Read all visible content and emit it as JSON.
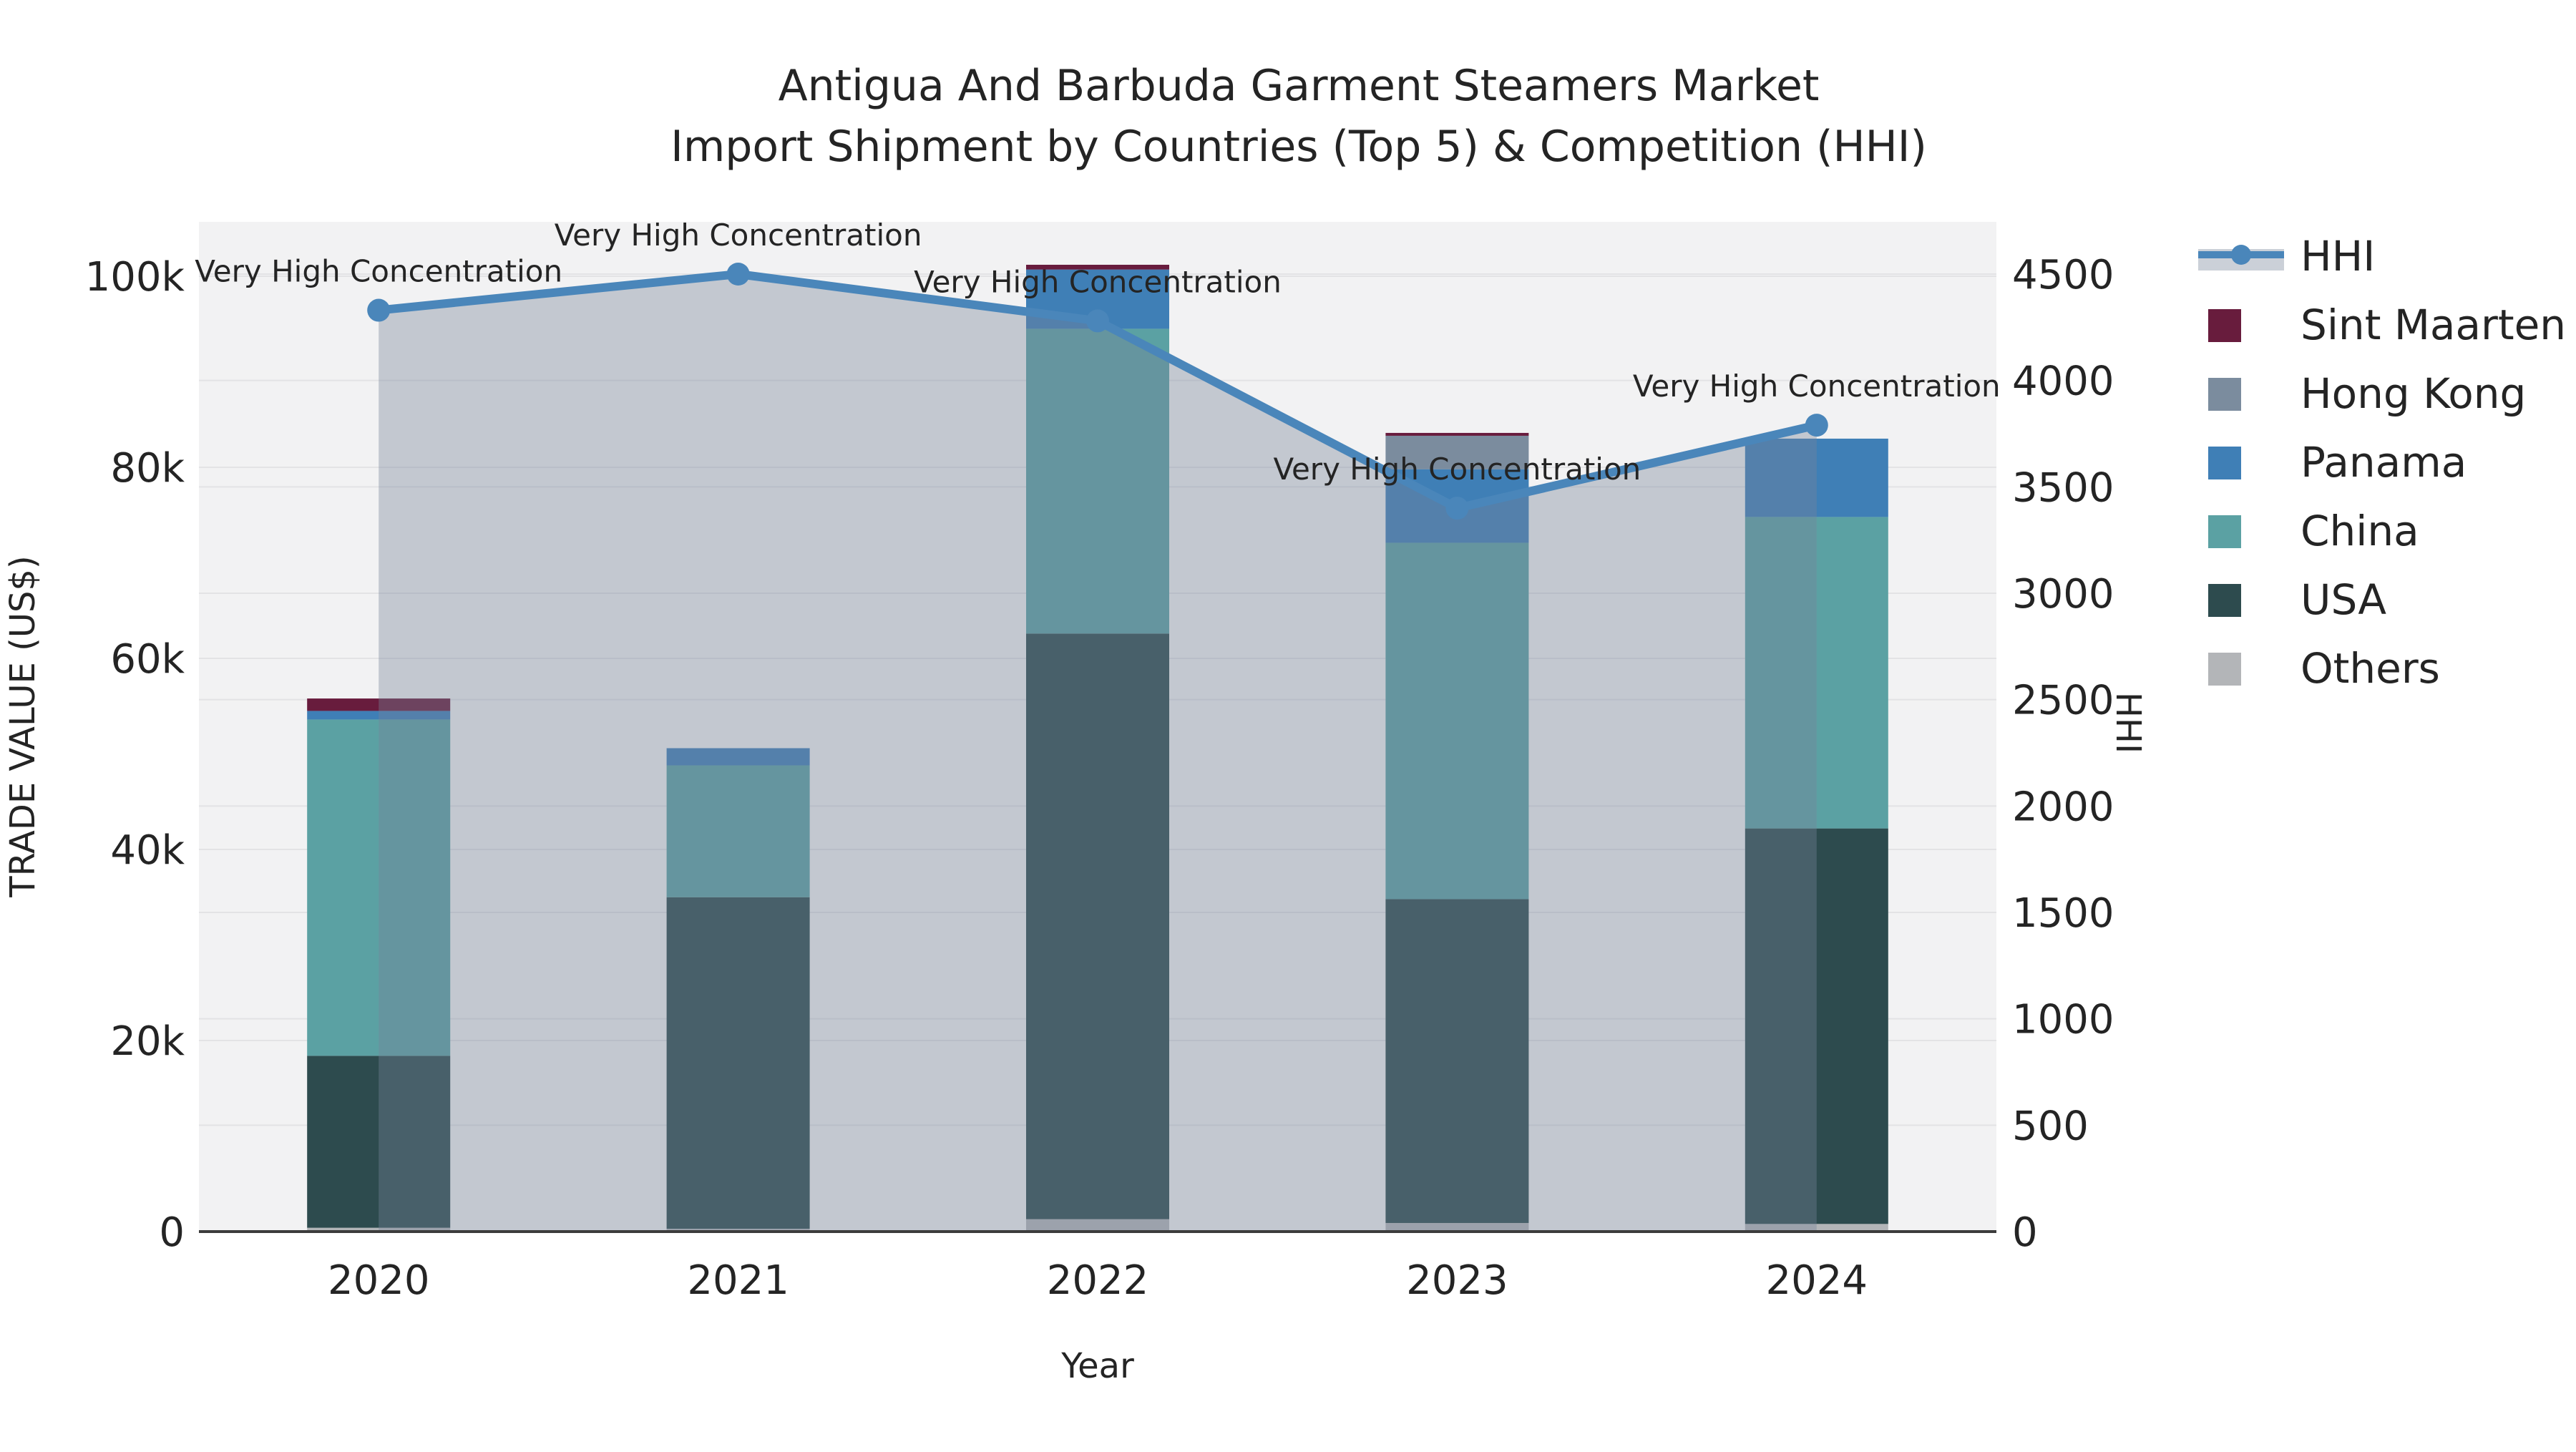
{
  "title": {
    "line1": "Antigua And Barbuda Garment Steamers Market",
    "line2": "Import Shipment by Countries (Top 5) & Competition (HHI)"
  },
  "axes": {
    "x": {
      "title": "Year",
      "categories": [
        "2020",
        "2021",
        "2022",
        "2023",
        "2024"
      ]
    },
    "y_left": {
      "title": "TRADE VALUE (US$)",
      "ticks": [
        {
          "value": 0,
          "label": "0"
        },
        {
          "value": 20000,
          "label": "20k"
        },
        {
          "value": 40000,
          "label": "40k"
        },
        {
          "value": 60000,
          "label": "60k"
        },
        {
          "value": 80000,
          "label": "80k"
        },
        {
          "value": 100000,
          "label": "100k"
        }
      ],
      "range": [
        0,
        106000
      ]
    },
    "y_right": {
      "title": "HHI",
      "ticks": [
        {
          "value": 0,
          "label": "0"
        },
        {
          "value": 500,
          "label": "500"
        },
        {
          "value": 1000,
          "label": "1000"
        },
        {
          "value": 1500,
          "label": "1500"
        },
        {
          "value": 2000,
          "label": "2000"
        },
        {
          "value": 2500,
          "label": "2500"
        },
        {
          "value": 3000,
          "label": "3000"
        },
        {
          "value": 3500,
          "label": "3500"
        },
        {
          "value": 4000,
          "label": "4000"
        },
        {
          "value": 4500,
          "label": "4500"
        }
      ],
      "range": [
        0,
        4790
      ]
    }
  },
  "legend": {
    "items": [
      {
        "label": "HHI",
        "type": "line",
        "color": "#4a86ba"
      },
      {
        "label": "Sint Maarten",
        "type": "bar",
        "color": "#681c3d"
      },
      {
        "label": "Hong Kong",
        "type": "bar",
        "color": "#7b8c9e"
      },
      {
        "label": "Panama",
        "type": "bar",
        "color": "#3f7fb6"
      },
      {
        "label": "China",
        "type": "bar",
        "color": "#5ba1a3"
      },
      {
        "label": "USA",
        "type": "bar",
        "color": "#2d4b4e"
      },
      {
        "label": "Others",
        "type": "bar",
        "color": "#b3b5b8"
      }
    ]
  },
  "chart_data": {
    "type": "combo",
    "subtypes": [
      "stacked-bar",
      "line+area"
    ],
    "categories": [
      "2020",
      "2021",
      "2022",
      "2023",
      "2024"
    ],
    "bar_value_unit": "US$",
    "bar_stack_order_bottom_to_top": [
      "Others",
      "USA",
      "China",
      "Panama",
      "Hong Kong",
      "Sint Maarten"
    ],
    "series": [
      {
        "name": "Others",
        "type": "bar",
        "axis": "left",
        "values": [
          400,
          300,
          1300,
          900,
          800
        ]
      },
      {
        "name": "USA",
        "type": "bar",
        "axis": "left",
        "values": [
          18000,
          34700,
          61300,
          33900,
          41400
        ]
      },
      {
        "name": "China",
        "type": "bar",
        "axis": "left",
        "values": [
          35200,
          13800,
          31900,
          37300,
          32600
        ]
      },
      {
        "name": "Panama",
        "type": "bar",
        "axis": "left",
        "values": [
          900,
          1800,
          6200,
          7700,
          8200
        ]
      },
      {
        "name": "Hong Kong",
        "type": "bar",
        "axis": "left",
        "values": [
          0,
          0,
          0,
          3500,
          0
        ]
      },
      {
        "name": "Sint Maarten",
        "type": "bar",
        "axis": "left",
        "values": [
          1300,
          0,
          500,
          300,
          0
        ]
      },
      {
        "name": "HHI",
        "type": "line",
        "axis": "right",
        "values": [
          4330,
          4500,
          4280,
          3400,
          3790
        ]
      }
    ],
    "bar_totals_approx": [
      55800,
      50600,
      101200,
      83600,
      83000
    ],
    "annotations": [
      {
        "category": "2020",
        "text": "Very High Concentration"
      },
      {
        "category": "2021",
        "text": "Very High Concentration"
      },
      {
        "category": "2022",
        "text": "Very High Concentration"
      },
      {
        "category": "2023",
        "text": "Very High Concentration"
      },
      {
        "category": "2024",
        "text": "Very High Concentration"
      }
    ],
    "legend_position": "right",
    "grid": true
  },
  "colors": {
    "hhi_line": "#4a86ba",
    "hhi_area_fill": "rgba(118,132,152,0.38)",
    "sint_maarten": "#681c3d",
    "hong_kong": "#7b8c9e",
    "panama": "#3f7fb6",
    "china": "#5ba1a3",
    "usa": "#2d4b4e",
    "others": "#b3b5b8",
    "plot_background": "#f2f2f3",
    "gridline": "#e3e3e5",
    "zero_line": "#3c3c3c",
    "text": "#242424"
  }
}
